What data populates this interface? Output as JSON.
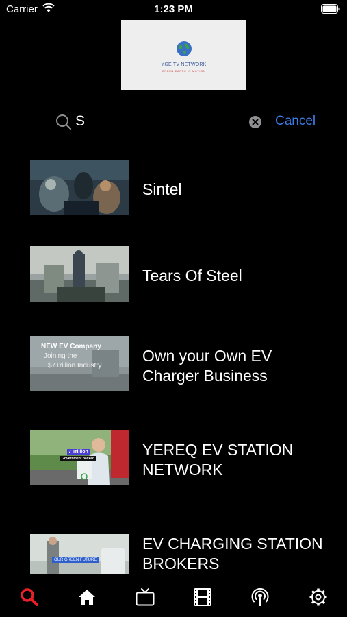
{
  "status_bar": {
    "carrier": "Carrier",
    "time": "1:23 PM"
  },
  "logo": {
    "title": "YGE TV NETWORK",
    "tagline": "GREEN EARTH IN MOTION"
  },
  "search": {
    "query": "S",
    "cancel_label": "Cancel"
  },
  "results": [
    {
      "title": "Sintel"
    },
    {
      "title": "Tears Of Steel"
    },
    {
      "title": "Own your Own EV Charger Business",
      "thumb_heading": "NEW EV Company",
      "thumb_line1": "Joining the",
      "thumb_line2": "$7Trillion Industry"
    },
    {
      "title": "YEREQ EV STATION NETWORK",
      "thumb_badge": "7 Trillion",
      "thumb_sub": "Government backed"
    },
    {
      "title": "EV CHARGING STATION BROKERS",
      "thumb_badge": "OUR GREEN FUTURE"
    }
  ],
  "tab_bar": {
    "tabs": [
      "search-icon",
      "home-icon",
      "tv-icon",
      "film-icon",
      "podcast-icon",
      "settings-icon"
    ],
    "active_color": "#e8202a",
    "inactive_color": "#ffffff"
  },
  "colors": {
    "accent": "#3b7de8",
    "background": "#000000"
  }
}
